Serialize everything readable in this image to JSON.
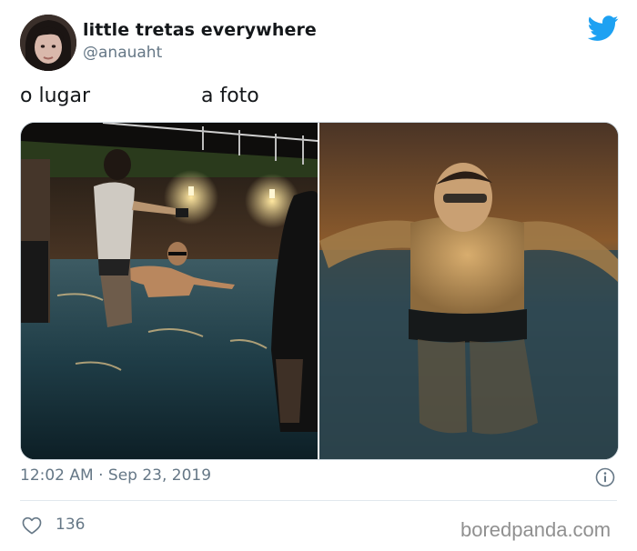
{
  "tweet": {
    "author": {
      "display_name": "little tretas everywhere",
      "handle": "@anauaht"
    },
    "caption": {
      "left": "o lugar",
      "right": "a foto"
    },
    "timestamp": "12:02 AM · Sep 23, 2019",
    "likes": "136",
    "watermark": "boredpanda.com",
    "accent_color": "#1da1f2",
    "icons": {
      "brand": "twitter-bird-icon",
      "info": "info-icon",
      "like": "heart-outline-icon"
    }
  }
}
